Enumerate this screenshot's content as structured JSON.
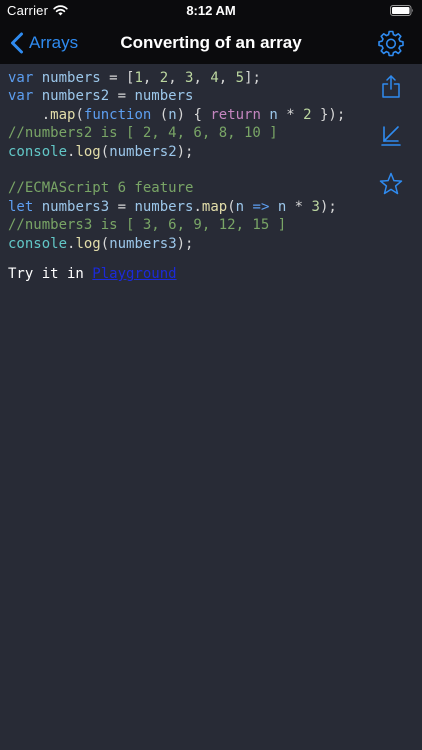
{
  "status_bar": {
    "carrier": "Carrier",
    "time": "8:12 AM"
  },
  "nav": {
    "back_label": "Arrays",
    "title": "Converting of an array"
  },
  "colors": {
    "accent": "#2f8bf0",
    "nav_background": "#0b0b0d",
    "content_background": "#282b36",
    "link": "#1b2ad8"
  },
  "code_lines": [
    [
      {
        "text": "var",
        "cls": "kw"
      },
      {
        "text": " numbers ",
        "cls": "ident"
      },
      {
        "text": "= [",
        "cls": "plain"
      },
      {
        "text": "1",
        "cls": "num"
      },
      {
        "text": ", ",
        "cls": "plain"
      },
      {
        "text": "2",
        "cls": "num"
      },
      {
        "text": ", ",
        "cls": "plain"
      },
      {
        "text": "3",
        "cls": "num"
      },
      {
        "text": ", ",
        "cls": "plain"
      },
      {
        "text": "4",
        "cls": "num"
      },
      {
        "text": ", ",
        "cls": "plain"
      },
      {
        "text": "5",
        "cls": "num"
      },
      {
        "text": "];",
        "cls": "plain"
      }
    ],
    [
      {
        "text": "var",
        "cls": "kw"
      },
      {
        "text": " numbers2 ",
        "cls": "ident"
      },
      {
        "text": "= ",
        "cls": "plain"
      },
      {
        "text": "numbers",
        "cls": "ident"
      }
    ],
    [
      {
        "text": "    .",
        "cls": "plain"
      },
      {
        "text": "map",
        "cls": "func"
      },
      {
        "text": "(",
        "cls": "plain"
      },
      {
        "text": "function",
        "cls": "kw"
      },
      {
        "text": " (",
        "cls": "plain"
      },
      {
        "text": "n",
        "cls": "ident"
      },
      {
        "text": ") { ",
        "cls": "plain"
      },
      {
        "text": "return",
        "cls": "pink"
      },
      {
        "text": " ",
        "cls": "plain"
      },
      {
        "text": "n",
        "cls": "ident"
      },
      {
        "text": " * ",
        "cls": "plain"
      },
      {
        "text": "2",
        "cls": "num"
      },
      {
        "text": " });",
        "cls": "plain"
      }
    ],
    [
      {
        "text": "//numbers2 is [ 2, 4, 6, 8, 10 ]",
        "cls": "comment"
      }
    ],
    [
      {
        "text": "console",
        "cls": "console"
      },
      {
        "text": ".",
        "cls": "plain"
      },
      {
        "text": "log",
        "cls": "func"
      },
      {
        "text": "(",
        "cls": "plain"
      },
      {
        "text": "numbers2",
        "cls": "ident"
      },
      {
        "text": ");",
        "cls": "plain"
      }
    ],
    [],
    [
      {
        "text": "//ECMAScript 6 feature",
        "cls": "comment"
      }
    ],
    [
      {
        "text": "let",
        "cls": "kw"
      },
      {
        "text": " numbers3 ",
        "cls": "ident"
      },
      {
        "text": "= ",
        "cls": "plain"
      },
      {
        "text": "numbers",
        "cls": "ident"
      },
      {
        "text": ".",
        "cls": "plain"
      },
      {
        "text": "map",
        "cls": "func"
      },
      {
        "text": "(",
        "cls": "plain"
      },
      {
        "text": "n",
        "cls": "ident"
      },
      {
        "text": " ",
        "cls": "plain"
      },
      {
        "text": "=>",
        "cls": "kw"
      },
      {
        "text": " ",
        "cls": "plain"
      },
      {
        "text": "n",
        "cls": "ident"
      },
      {
        "text": " * ",
        "cls": "plain"
      },
      {
        "text": "3",
        "cls": "num"
      },
      {
        "text": ");",
        "cls": "plain"
      }
    ],
    [
      {
        "text": "//numbers3 is [ 3, 6, 9, 12, 15 ]",
        "cls": "comment"
      }
    ],
    [
      {
        "text": "console",
        "cls": "console"
      },
      {
        "text": ".",
        "cls": "plain"
      },
      {
        "text": "log",
        "cls": "func"
      },
      {
        "text": "(",
        "cls": "plain"
      },
      {
        "text": "numbers3",
        "cls": "ident"
      },
      {
        "text": ");",
        "cls": "plain"
      }
    ]
  ],
  "try_it": {
    "prefix": "Try it in ",
    "link_label": "Playground"
  },
  "side_actions": [
    {
      "name": "share-icon"
    },
    {
      "name": "run-icon"
    },
    {
      "name": "star-icon"
    }
  ]
}
